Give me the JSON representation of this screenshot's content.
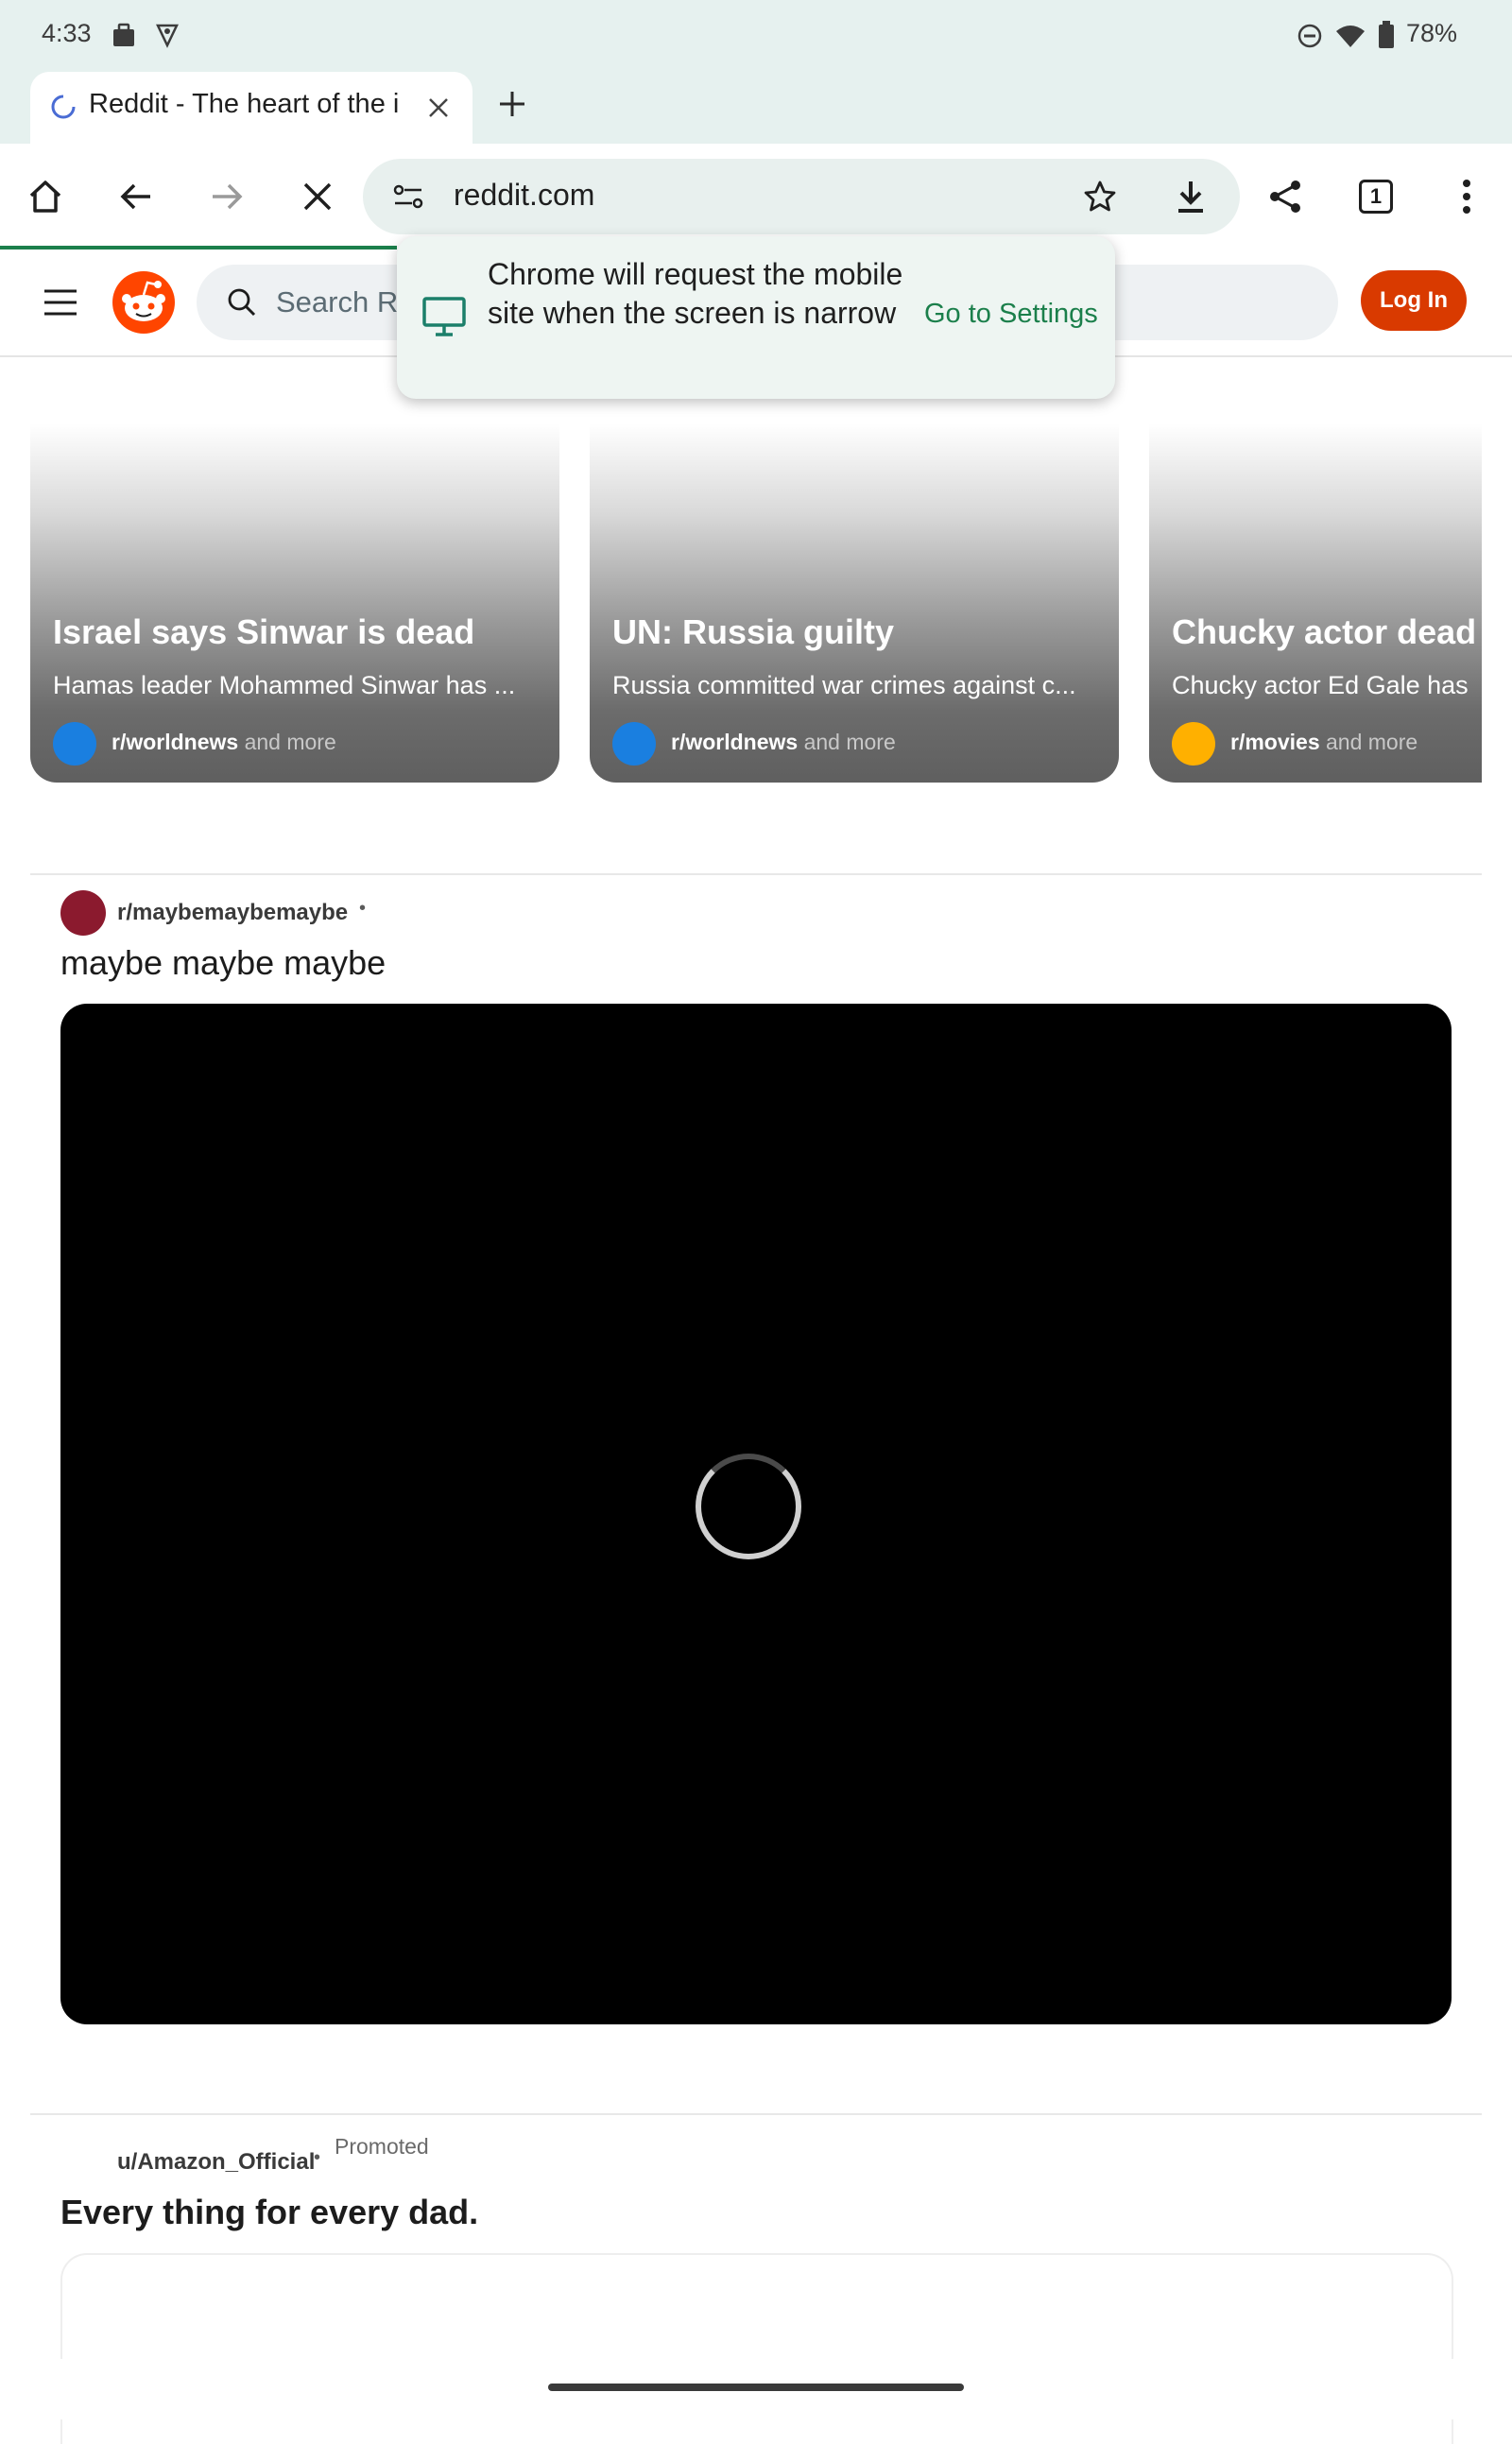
{
  "status_bar": {
    "time": "4:33",
    "battery": "78%",
    "icons": [
      "briefcase-icon",
      "vpn-shield-icon",
      "dnd-icon",
      "wifi-icon",
      "battery-icon"
    ]
  },
  "tab": {
    "title": "Reddit - The heart of the in"
  },
  "omnibox": {
    "url": "reddit.com"
  },
  "toolbar": {
    "tab_count": "1"
  },
  "reddit_header": {
    "search_placeholder": "Search R",
    "login_label": "Log In"
  },
  "popup": {
    "message": "Chrome will request the mobile site when the screen is narrow",
    "action": "Go to Settings"
  },
  "cards": [
    {
      "title": "Israel says Sinwar is dead",
      "subtitle": "Hamas leader Mohammed Sinwar has ...",
      "subreddit": "r/worldnews",
      "more": "and more",
      "dot_color": "#1a7fe0"
    },
    {
      "title": "UN: Russia guilty",
      "subtitle": "Russia committed war crimes against c...",
      "subreddit": "r/worldnews",
      "more": "and more",
      "dot_color": "#1a7fe0"
    },
    {
      "title": "Chucky actor dead a",
      "subtitle": "Chucky actor Ed Gale has d",
      "subreddit": "r/movies",
      "more": "and more",
      "dot_color": "#ffb000"
    }
  ],
  "post": {
    "subreddit": "r/maybemaybemaybe",
    "separator": "•",
    "title": "maybe maybe maybe",
    "avatar_color": "#8b1a2e"
  },
  "promoted_post": {
    "user": "u/Amazon_Official",
    "separator": "•",
    "tag": "Promoted",
    "title": "Every thing for every dad."
  },
  "colors": {
    "chrome_bg": "#e6f1ef",
    "accent_green": "#1b7f4b",
    "reddit_orange": "#d93a00"
  }
}
